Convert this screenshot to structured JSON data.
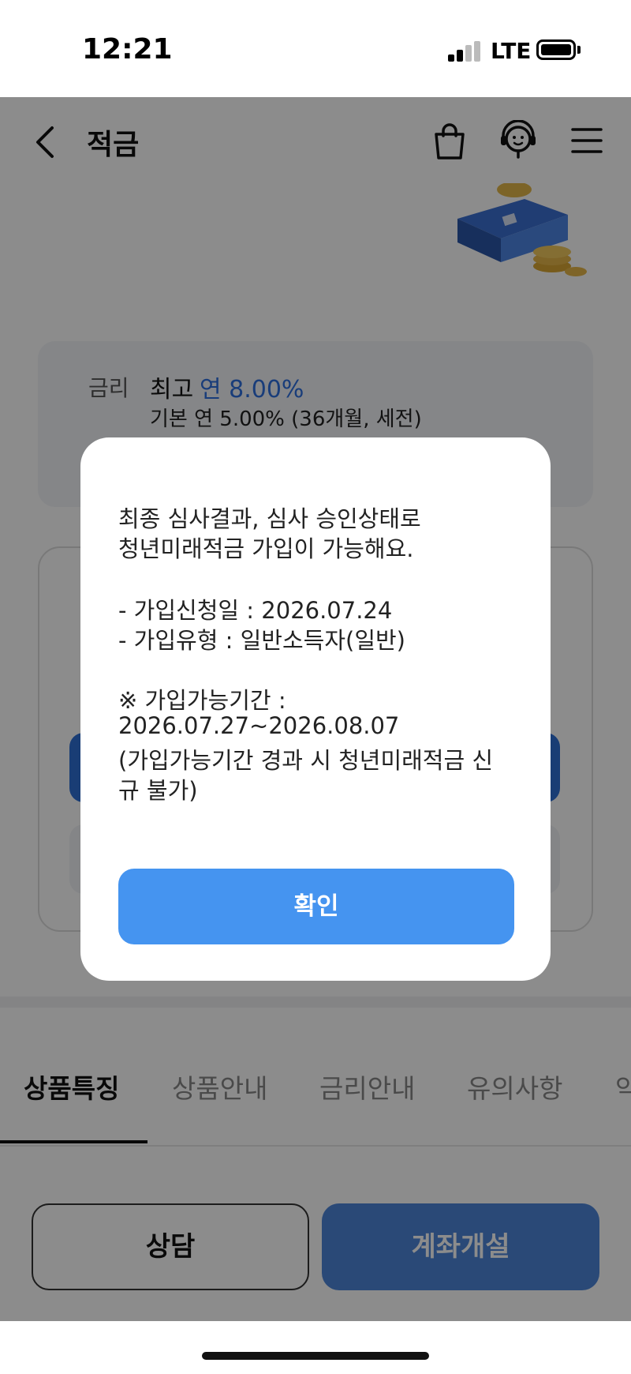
{
  "status_bar": {
    "time": "12:21",
    "network": "LTE"
  },
  "header": {
    "title": "적금"
  },
  "rate_card": {
    "label": "금리",
    "max_prefix": "최고",
    "max_value": "연 8.00%",
    "base": "기본 연 5.00% (36개월, 세전)"
  },
  "tabs": [
    "상품특징",
    "상품안내",
    "금리안내",
    "유의사항",
    "약"
  ],
  "bottom": {
    "consult_label": "상담",
    "open_label": "계좌개설"
  },
  "dialog": {
    "lines": [
      "최종 심사결과, 심사 승인상태로",
      "청년미래적금 가입이 가능해요.",
      "- 가입신청일 : 2026.07.24",
      "- 가입유형 : 일반소득자(일반)",
      "※ 가입가능기간 :",
      "2026.07.27~2026.08.07",
      "(가입가능기간 경과 시 청년미래적금 신",
      "규 불가)"
    ],
    "confirm_label": "확인"
  },
  "colors": {
    "accent_blue": "#4594f0",
    "rate_blue": "#2f6fdf",
    "dim": "rgba(0,0,0,0.45)"
  },
  "icons": [
    "back-arrow-icon",
    "shopping-bag-icon",
    "chatbot-headset-icon",
    "hamburger-menu-icon",
    "cellular-signal-icon",
    "battery-icon"
  ]
}
